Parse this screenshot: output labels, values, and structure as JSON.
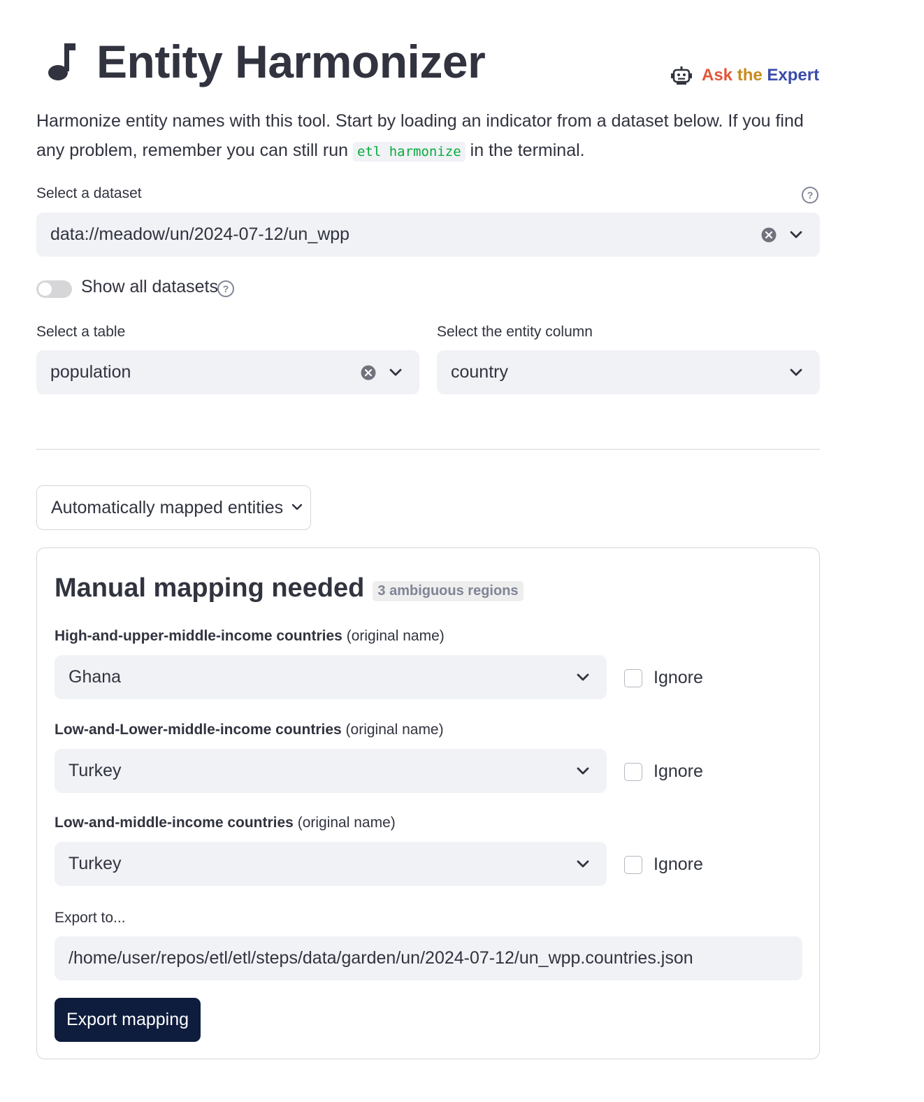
{
  "header": {
    "title": "Entity Harmonizer",
    "title_icon": "music-note-icon",
    "ask_expert": {
      "icon": "robot-icon",
      "parts": [
        "Ask",
        " the",
        " E",
        "xpe",
        "rt"
      ]
    }
  },
  "intro": {
    "before": "Harmonize entity names with this tool. Start by loading an indicator from a dataset below. If you find any problem, remember you can still run ",
    "code": "etl harmonize",
    "after": " in the terminal."
  },
  "dataset": {
    "label": "Select a dataset",
    "value": "data://meadow/un/2024-07-12/un_wpp"
  },
  "show_all": {
    "label": "Show all datasets",
    "enabled": false
  },
  "table": {
    "label": "Select a table",
    "value": "population"
  },
  "entity_column": {
    "label": "Select the entity column",
    "value": "country"
  },
  "auto_mapped": {
    "label": "Automatically mapped entities"
  },
  "manual": {
    "title": "Manual mapping needed",
    "badge": "3 ambiguous regions",
    "suffix": "(original name)",
    "ignore_label": "Ignore",
    "rows": [
      {
        "name": "High-and-upper-middle-income countries",
        "value": "Ghana",
        "ignored": false
      },
      {
        "name": "Low-and-Lower-middle-income countries",
        "value": "Turkey",
        "ignored": false
      },
      {
        "name": "Low-and-middle-income countries",
        "value": "Turkey",
        "ignored": false
      }
    ],
    "export_label": "Export to...",
    "export_path": "/home/user/repos/etl/etl/steps/data/garden/un/2024-07-12/un_wpp.countries.json",
    "export_button": "Export mapping"
  },
  "colors": {
    "text": "#31333f",
    "input_bg": "#f0f2f6",
    "button_bg": "#0e1d3d",
    "code_green": "#09ab3b"
  }
}
